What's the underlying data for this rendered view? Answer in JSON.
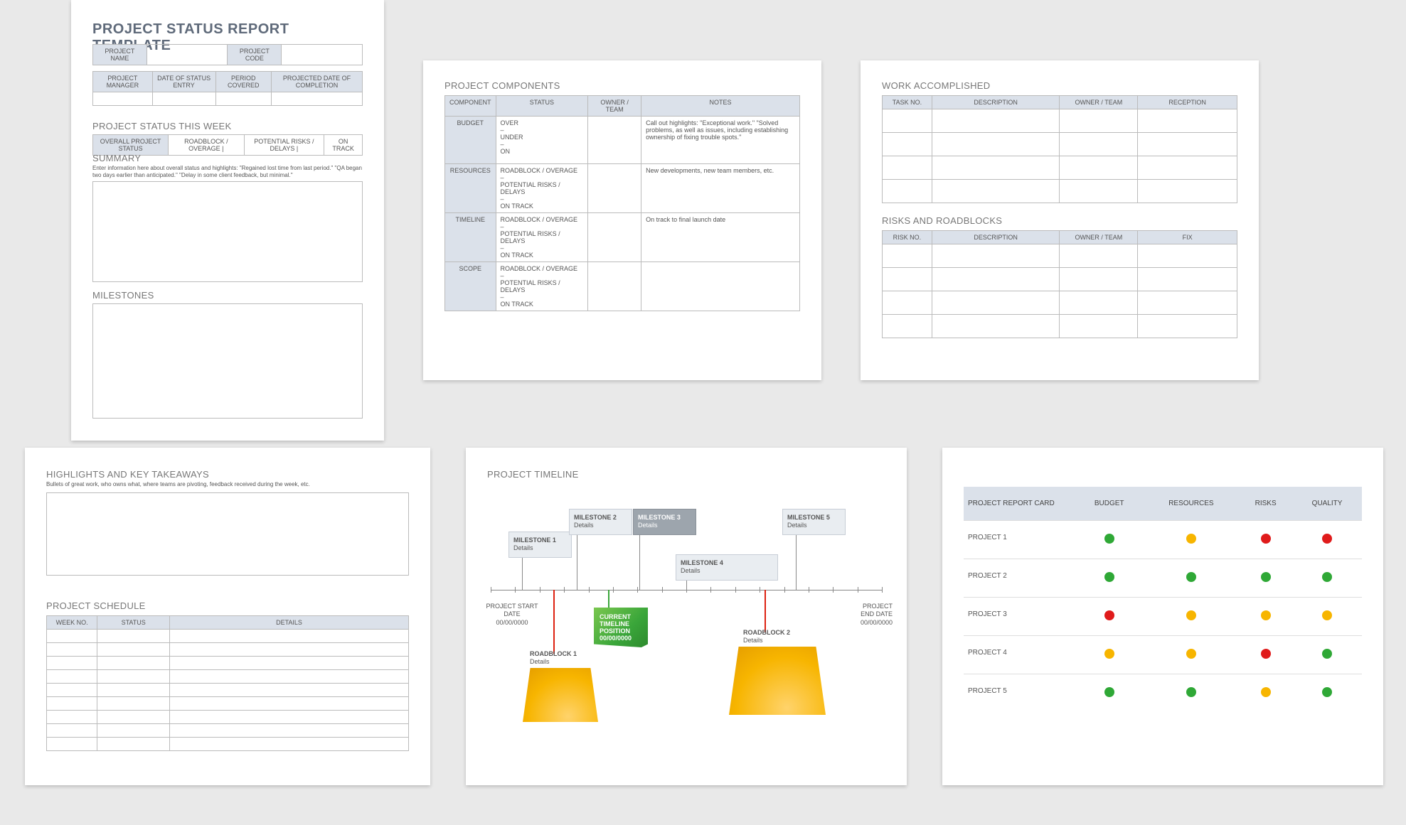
{
  "page1": {
    "title": "PROJECT STATUS REPORT TEMPLATE",
    "meta1": {
      "name": "PROJECT NAME",
      "code": "PROJECT CODE"
    },
    "meta2": [
      "PROJECT MANAGER",
      "DATE OF STATUS ENTRY",
      "PERIOD COVERED",
      "PROJECTED DATE OF COMPLETION"
    ],
    "status_title": "PROJECT STATUS THIS WEEK",
    "status_labels": [
      "OVERALL PROJECT STATUS",
      "ROADBLOCK / OVERAGE   |",
      "POTENTIAL RISKS / DELAYS   |",
      "ON TRACK"
    ],
    "summary_title": "SUMMARY",
    "summary_hint": "Enter information here about overall status and highlights: \"Regained lost time from last period.\" \"QA began two days earlier than anticipated.\" \"Delay in some client feedback, but minimal.\"",
    "milestones_title": "MILESTONES"
  },
  "page2": {
    "title": "PROJECT COMPONENTS",
    "headers": [
      "COMPONENT",
      "STATUS",
      "OWNER / TEAM",
      "NOTES"
    ],
    "rows": [
      {
        "component": "BUDGET",
        "status": "OVER\n–\nUNDER\n–\nON",
        "notes": "Call out highlights:  \"Exceptional work.\"  \"Solved problems, as well as issues, including establishing ownership of fixing trouble spots.\""
      },
      {
        "component": "RESOURCES",
        "status": "ROADBLOCK / OVERAGE\n–\nPOTENTIAL RISKS / DELAYS\n–\nON TRACK",
        "notes": "New developments, new team members, etc."
      },
      {
        "component": "TIMELINE",
        "status": "ROADBLOCK / OVERAGE\n–\nPOTENTIAL RISKS / DELAYS\n–\nON TRACK",
        "notes": "On track to final launch date"
      },
      {
        "component": "SCOPE",
        "status": "ROADBLOCK / OVERAGE\n–\nPOTENTIAL RISKS / DELAYS\n–\nON TRACK",
        "notes": ""
      }
    ]
  },
  "page3": {
    "work_title": "WORK ACCOMPLISHED",
    "work_headers": [
      "TASK NO.",
      "DESCRIPTION",
      "OWNER / TEAM",
      "RECEPTION"
    ],
    "risk_title": "RISKS AND ROADBLOCKS",
    "risk_headers": [
      "RISK NO.",
      "DESCRIPTION",
      "OWNER / TEAM",
      "FIX"
    ]
  },
  "page4": {
    "title": "HIGHLIGHTS AND KEY TAKEAWAYS",
    "hint": "Bullets of great work, who owns what, where teams are pivoting, feedback received during the week, etc.",
    "sched_title": "PROJECT SCHEDULE",
    "sched_headers": [
      "WEEK NO.",
      "STATUS",
      "DETAILS"
    ]
  },
  "page5": {
    "title": "PROJECT TIMELINE",
    "start": {
      "l1": "PROJECT START",
      "l2": "DATE",
      "l3": "00/00/0000"
    },
    "end": {
      "l1": "PROJECT",
      "l2": "END DATE",
      "l3": "00/00/0000"
    },
    "milestones": [
      {
        "name": "MILESTONE 1",
        "sub": "Details"
      },
      {
        "name": "MILESTONE 2",
        "sub": "Details"
      },
      {
        "name": "MILESTONE 3",
        "sub": "Details"
      },
      {
        "name": "MILESTONE 4",
        "sub": "Details"
      },
      {
        "name": "MILESTONE 5",
        "sub": "Details"
      }
    ],
    "current": {
      "l1": "CURRENT",
      "l2": "TIMELINE",
      "l3": "POSITION",
      "l4": "00/00/0000"
    },
    "roadblocks": [
      {
        "name": "ROADBLOCK 1",
        "sub": "Details"
      },
      {
        "name": "ROADBLOCK 2",
        "sub": "Details"
      }
    ]
  },
  "page6": {
    "header": [
      "PROJECT REPORT CARD",
      "BUDGET",
      "RESOURCES",
      "RISKS",
      "QUALITY"
    ],
    "rows": [
      {
        "name": "PROJECT 1",
        "dots": [
          "g",
          "y",
          "r",
          "r"
        ]
      },
      {
        "name": "PROJECT 2",
        "dots": [
          "g",
          "g",
          "g",
          "g"
        ]
      },
      {
        "name": "PROJECT 3",
        "dots": [
          "r",
          "y",
          "y",
          "y"
        ]
      },
      {
        "name": "PROJECT 4",
        "dots": [
          "y",
          "y",
          "r",
          "g"
        ]
      },
      {
        "name": "PROJECT 5",
        "dots": [
          "g",
          "g",
          "y",
          "g"
        ]
      }
    ]
  }
}
